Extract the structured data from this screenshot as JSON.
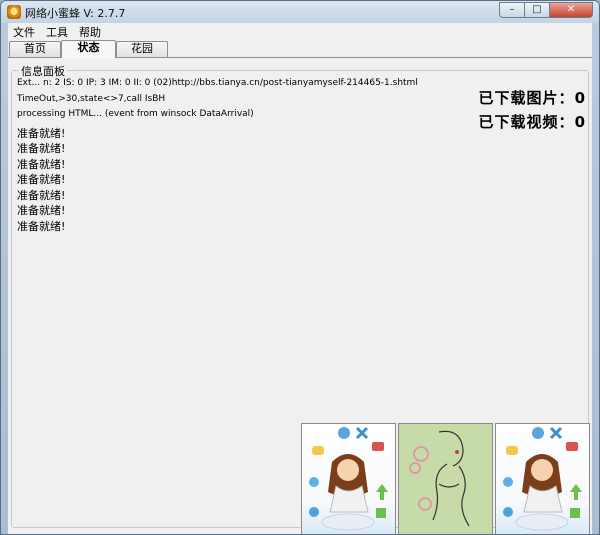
{
  "window": {
    "title": "网络小蜜蜂 V: 2.7.7"
  },
  "caption_buttons": {
    "minimize": "–",
    "maximize": "□",
    "close": "✕"
  },
  "menu": [
    "文件",
    "工具",
    "帮助"
  ],
  "tabs": [
    {
      "label": "首页",
      "active": false
    },
    {
      "label": "状态",
      "active": true
    },
    {
      "label": "花园",
      "active": false
    }
  ],
  "info_panel": {
    "title": "信息面板",
    "log_lines": [
      "Ext... n: 2 IS: 0 IP: 3 IM: 0 II: 0 (02)http://bbs.tianya.cn/post-tianyamyself-214465-1.shtml",
      "TimeOut,>30,state<>7,call IsBH",
      "processing HTML... (event from winsock DataArrival)",
      "准备就绪!",
      "准备就绪!",
      "准备就绪!",
      "准备就绪!",
      "准备就绪!",
      "准备就绪!",
      "准备就绪!"
    ],
    "downloaded_images_label": "已下载图片：",
    "downloaded_images_count": "0",
    "downloaded_videos_label": "已下载视频：",
    "downloaded_videos_count": "0"
  },
  "thumbnails": [
    {
      "name": "girl-with-web-icons-illustration"
    },
    {
      "name": "line-art-woman-illustration"
    },
    {
      "name": "girl-with-web-icons-illustration"
    }
  ]
}
